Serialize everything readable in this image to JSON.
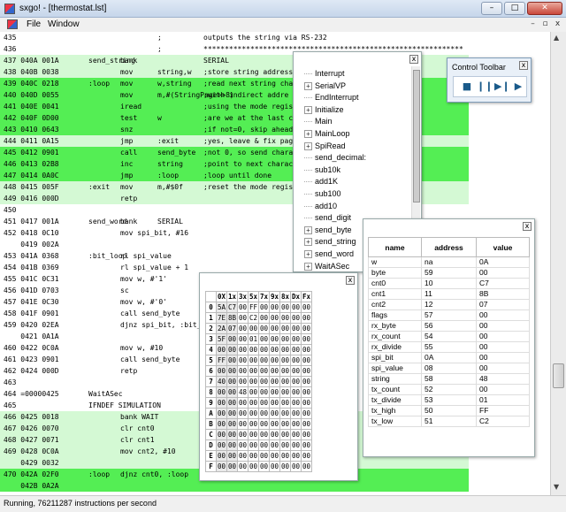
{
  "window": {
    "title": "sxgo! - [thermostat.lst]",
    "min": "–",
    "max": "□",
    "close": "✕"
  },
  "menu": {
    "file": "File",
    "window": "Window",
    "mdi_min": "–",
    "mdi_restore": "▫",
    "mdi_close": "x"
  },
  "listing": [
    {
      "bg": "",
      "a": "435",
      "b": "",
      "c": "",
      "d": ";",
      "e": "outputs the string via RS-232"
    },
    {
      "bg": "",
      "a": "436",
      "b": "",
      "c": "",
      "d": ";",
      "e": "*************************************************************"
    },
    {
      "bg": "light",
      "a": "437 040A 001A",
      "b": "send_string",
      "c": "bank",
      "d": "",
      "e": "SERIAL"
    },
    {
      "bg": "light",
      "a": "438 040B 0038",
      "b": "",
      "c": "mov",
      "d": "string,w",
      "e": ";store string address"
    },
    {
      "bg": "bright",
      "a": "439 040C 0218",
      "b": ":loop",
      "c": "mov",
      "d": "w,string",
      "e": ";read next string charact"
    },
    {
      "bg": "bright",
      "a": "440 040D 0055",
      "b": "",
      "c": "mov",
      "d": "m,#(StringPage>>8)",
      "e": ";with indirect addre"
    },
    {
      "bg": "bright",
      "a": "441 040E 0041",
      "b": "",
      "c": "iread",
      "d": "",
      "e": ";using the mode register"
    },
    {
      "bg": "bright",
      "a": "442 040F 0D00",
      "b": "",
      "c": "test",
      "d": "w",
      "e": ";are we at the last char?"
    },
    {
      "bg": "bright",
      "a": "443 0410 0643",
      "b": "",
      "c": "snz",
      "d": "",
      "e": ";if not=0, skip ahead"
    },
    {
      "bg": "light",
      "a": "444 0411 0A15",
      "b": "",
      "c": "jmp",
      "d": ":exit",
      "e": ";yes, leave & fix page bits"
    },
    {
      "bg": "bright",
      "a": "445 0412 0901",
      "b": "",
      "c": "call",
      "d": "send_byte",
      "e": ";not 0, so send character"
    },
    {
      "bg": "bright",
      "a": "446 0413 02B8",
      "b": "",
      "c": "inc",
      "d": "string",
      "e": ";point to next character"
    },
    {
      "bg": "bright",
      "a": "447 0414 0A0C",
      "b": "",
      "c": "jmp",
      "d": ":loop",
      "e": ";loop until done"
    },
    {
      "bg": "light",
      "a": "448 0415 005F",
      "b": ":exit",
      "c": "mov",
      "d": "m,#$0f",
      "e": ";reset the mode register"
    },
    {
      "bg": "light",
      "a": "449 0416 000D",
      "b": "",
      "c": "retp",
      "d": "",
      "e": ""
    },
    {
      "bg": "",
      "a": "450",
      "b": "",
      "c": "",
      "d": "",
      "e": ""
    },
    {
      "bg": "",
      "a": "451 0417 001A",
      "b": "send_word",
      "c": "bank",
      "d": "SERIAL",
      "e": ""
    },
    {
      "bg": "",
      "a": "452 0418 0C10",
      "b": "",
      "c": "mov spi_bit, #16",
      "d": "",
      "e": ""
    },
    {
      "bg": "",
      "a": "    0419 002A",
      "b": "",
      "c": "",
      "d": "",
      "e": ""
    },
    {
      "bg": "",
      "a": "453 041A 0368",
      "b": ":bit_loop",
      "c": "rl spi_value",
      "d": "",
      "e": ""
    },
    {
      "bg": "",
      "a": "454 041B 0369",
      "b": "",
      "c": "rl spi_value + 1",
      "d": "",
      "e": ""
    },
    {
      "bg": "",
      "a": "455 041C 0C31",
      "b": "",
      "c": "mov w, #'1'",
      "d": "",
      "e": ""
    },
    {
      "bg": "",
      "a": "456 041D 0703",
      "b": "",
      "c": "sc",
      "d": "",
      "e": ""
    },
    {
      "bg": "",
      "a": "457 041E 0C30",
      "b": "",
      "c": "mov w, #'0'",
      "d": "",
      "e": ""
    },
    {
      "bg": "",
      "a": "458 041F 0901",
      "b": "",
      "c": "call send_byte",
      "d": "",
      "e": ""
    },
    {
      "bg": "",
      "a": "459 0420 02EA",
      "b": "",
      "c": "djnz spi_bit, :bit_loop",
      "d": "",
      "e": ""
    },
    {
      "bg": "",
      "a": "    0421 0A1A",
      "b": "",
      "c": "",
      "d": "",
      "e": ""
    },
    {
      "bg": "",
      "a": "460 0422 0C0A",
      "b": "",
      "c": "mov w, #10",
      "d": "",
      "e": ""
    },
    {
      "bg": "",
      "a": "461 0423 0901",
      "b": "",
      "c": "call send_byte",
      "d": "",
      "e": ""
    },
    {
      "bg": "",
      "a": "462 0424 000D",
      "b": "",
      "c": "retp",
      "d": "",
      "e": ""
    },
    {
      "bg": "",
      "a": "463",
      "b": "",
      "c": "",
      "d": "",
      "e": ""
    },
    {
      "bg": "",
      "a": "464 =00000425",
      "b": "WaitASec",
      "c": "",
      "d": "",
      "e": ""
    },
    {
      "bg": "",
      "a": "465",
      "b": "IFNDEF SIMULATION",
      "c": "",
      "d": "",
      "e": ""
    },
    {
      "bg": "light",
      "a": "466 0425 0018",
      "b": "",
      "c": "bank WAIT",
      "d": "",
      "e": ""
    },
    {
      "bg": "light",
      "a": "467 0426 0070",
      "b": "",
      "c": "clr cnt0",
      "d": "",
      "e": ""
    },
    {
      "bg": "light",
      "a": "468 0427 0071",
      "b": "",
      "c": "clr cnt1",
      "d": "",
      "e": ""
    },
    {
      "bg": "light",
      "a": "469 0428 0C0A",
      "b": "",
      "c": "mov cnt2, #10",
      "d": "",
      "e": ""
    },
    {
      "bg": "light",
      "a": "    0429 0032",
      "b": "",
      "c": "",
      "d": "",
      "e": ""
    },
    {
      "bg": "bright",
      "a": "470 042A 02F0",
      "b": ":loop",
      "c": "djnz cnt0, :loop",
      "d": "",
      "e": ""
    },
    {
      "bg": "bright",
      "a": "    042B 0A2A",
      "b": "",
      "c": "",
      "d": "",
      "e": ""
    }
  ],
  "tree": {
    "items": [
      {
        "label": "Interrupt",
        "exp": false
      },
      {
        "label": "SerialVP",
        "exp": true
      },
      {
        "label": "EndInterrupt",
        "exp": false
      },
      {
        "label": "Initialize",
        "exp": true
      },
      {
        "label": "Main",
        "exp": false
      },
      {
        "label": "MainLoop",
        "exp": true
      },
      {
        "label": "SpiRead",
        "exp": true
      },
      {
        "label": "send_decimal:",
        "exp": false
      },
      {
        "label": "sub10k",
        "exp": false
      },
      {
        "label": "add1K",
        "exp": false
      },
      {
        "label": "sub100",
        "exp": false
      },
      {
        "label": "add10",
        "exp": false
      },
      {
        "label": "send_digit",
        "exp": false
      },
      {
        "label": "send_byte",
        "exp": true
      },
      {
        "label": "send_string",
        "exp": true
      },
      {
        "label": "send_word",
        "exp": true
      },
      {
        "label": "WaitASec",
        "exp": true
      }
    ]
  },
  "toolbar": {
    "title": "Control Toolbar",
    "buttons": [
      "■",
      "❙❙",
      "▶❙",
      "▶"
    ]
  },
  "memory": {
    "cols": [
      "0X",
      "1x",
      "3x",
      "5x",
      "7x",
      "9x",
      "8x",
      "Dx",
      "Fx"
    ],
    "rows": [
      {
        "label": "0",
        "cells": [
          "5A",
          "C7",
          "00",
          "FF",
          "00",
          "00",
          "00",
          "00",
          "00"
        ]
      },
      {
        "label": "1",
        "cells": [
          "7E",
          "8B",
          "00",
          "C2",
          "00",
          "00",
          "00",
          "00",
          "00"
        ]
      },
      {
        "label": "2",
        "cells": [
          "2A",
          "07",
          "00",
          "00",
          "00",
          "00",
          "00",
          "00",
          "00"
        ]
      },
      {
        "label": "3",
        "cells": [
          "5F",
          "00",
          "00",
          "01",
          "00",
          "00",
          "00",
          "00",
          "00"
        ]
      },
      {
        "label": "4",
        "cells": [
          "00",
          "00",
          "00",
          "00",
          "00",
          "00",
          "00",
          "00",
          "00"
        ]
      },
      {
        "label": "5",
        "cells": [
          "FF",
          "00",
          "00",
          "00",
          "00",
          "00",
          "00",
          "00",
          "00"
        ]
      },
      {
        "label": "6",
        "cells": [
          "00",
          "00",
          "00",
          "00",
          "00",
          "00",
          "00",
          "00",
          "00"
        ]
      },
      {
        "label": "7",
        "cells": [
          "40",
          "00",
          "00",
          "00",
          "00",
          "00",
          "00",
          "00",
          "00"
        ]
      },
      {
        "label": "8",
        "cells": [
          "00",
          "00",
          "48",
          "00",
          "00",
          "00",
          "00",
          "00",
          "00"
        ]
      },
      {
        "label": "9",
        "cells": [
          "00",
          "00",
          "00",
          "00",
          "00",
          "00",
          "00",
          "00",
          "00"
        ]
      },
      {
        "label": "A",
        "cells": [
          "00",
          "00",
          "00",
          "00",
          "00",
          "00",
          "00",
          "00",
          "00"
        ]
      },
      {
        "label": "B",
        "cells": [
          "00",
          "00",
          "00",
          "00",
          "00",
          "00",
          "00",
          "00",
          "00"
        ]
      },
      {
        "label": "C",
        "cells": [
          "00",
          "00",
          "00",
          "00",
          "00",
          "00",
          "00",
          "00",
          "00"
        ]
      },
      {
        "label": "D",
        "cells": [
          "00",
          "00",
          "00",
          "00",
          "00",
          "00",
          "00",
          "00",
          "00"
        ]
      },
      {
        "label": "E",
        "cells": [
          "00",
          "00",
          "00",
          "00",
          "00",
          "00",
          "00",
          "00",
          "00"
        ]
      },
      {
        "label": "F",
        "cells": [
          "00",
          "00",
          "00",
          "00",
          "00",
          "00",
          "00",
          "00",
          "00"
        ]
      }
    ]
  },
  "vars": {
    "headers": [
      "name",
      "address",
      "value"
    ],
    "rows": [
      [
        "w",
        "na",
        "0A"
      ],
      [
        "byte",
        "59",
        "00"
      ],
      [
        "cnt0",
        "10",
        "C7"
      ],
      [
        "cnt1",
        "11",
        "8B"
      ],
      [
        "cnt2",
        "12",
        "07"
      ],
      [
        "flags",
        "57",
        "00"
      ],
      [
        "rx_byte",
        "56",
        "00"
      ],
      [
        "rx_count",
        "54",
        "00"
      ],
      [
        "rx_divide",
        "55",
        "00"
      ],
      [
        "spi_bit",
        "0A",
        "00"
      ],
      [
        "spi_value",
        "08",
        "00"
      ],
      [
        "string",
        "58",
        "48"
      ],
      [
        "tx_count",
        "52",
        "00"
      ],
      [
        "tx_divide",
        "53",
        "01"
      ],
      [
        "tx_high",
        "50",
        "FF"
      ],
      [
        "tx_low",
        "51",
        "C2"
      ]
    ]
  },
  "status": "Running, 76211287 instructions per second",
  "colors": {
    "light_green": "#d4f9d4",
    "bright_green": "#54ee54"
  }
}
